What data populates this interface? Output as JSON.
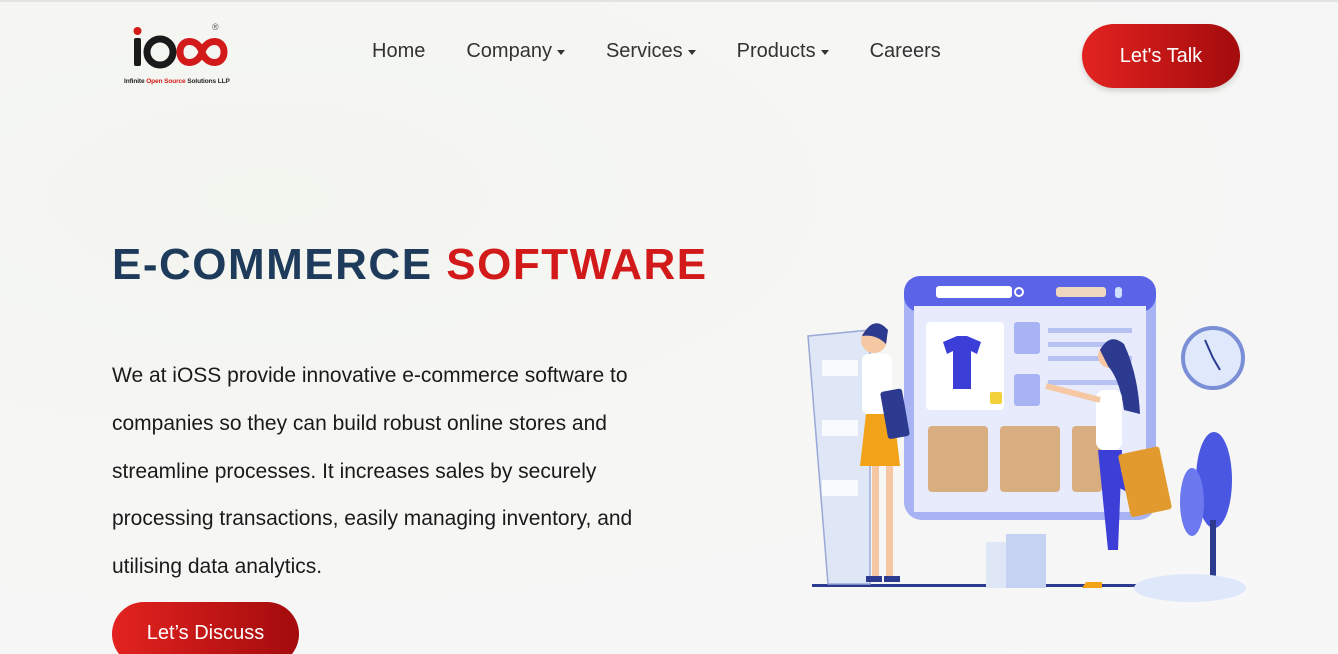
{
  "header": {
    "logo_registered": "®",
    "logo_tagline_parts": [
      "Infinite ",
      "Open ",
      "Source ",
      "Solutions LLP"
    ],
    "nav": [
      {
        "label": "Home",
        "dropdown": false
      },
      {
        "label": "Company",
        "dropdown": true
      },
      {
        "label": "Services",
        "dropdown": true
      },
      {
        "label": "Products",
        "dropdown": true
      },
      {
        "label": "Careers",
        "dropdown": false
      }
    ],
    "cta_label": "Let's Talk"
  },
  "hero": {
    "title_part1": "E-COMMERCE ",
    "title_part2": "SOFTWARE",
    "description": "We at iOSS provide innovative e-commerce software to companies so they can build robust online stores and streamline processes. It increases sales by securely processing transactions, easily managing inventory, and utilising data analytics.",
    "button_label": "Let’s Discuss"
  },
  "colors": {
    "brand_red": "#d31a1a",
    "title_dark": "#1f3b5b",
    "illustration_blue": "#5b63e6"
  },
  "icons": [
    "logo-icon",
    "search-icon",
    "mic-icon",
    "cart-icon",
    "heart-icon",
    "clock-icon"
  ]
}
